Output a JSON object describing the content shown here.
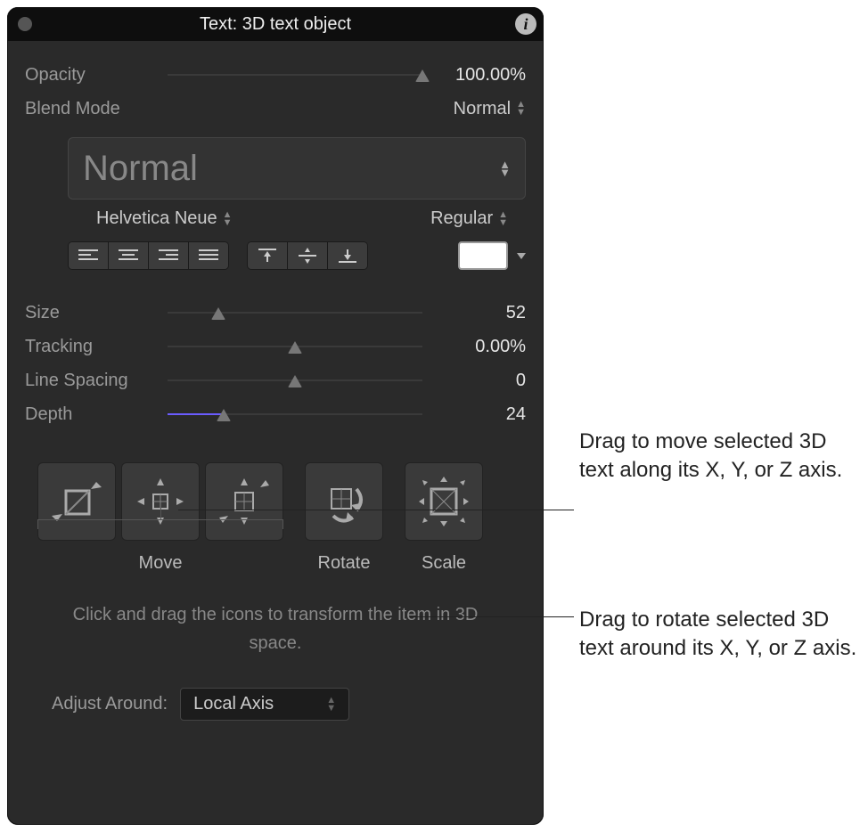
{
  "header": {
    "title": "Text: 3D text  object"
  },
  "opacity": {
    "label": "Opacity",
    "value": "100.00%",
    "pct": 100
  },
  "blend": {
    "label": "Blend Mode",
    "value": "Normal"
  },
  "typeface_dropdown": {
    "label": "Normal"
  },
  "font": {
    "family": "Helvetica Neue",
    "weight": "Regular"
  },
  "size": {
    "label": "Size",
    "value": "52",
    "pct": 20
  },
  "tracking": {
    "label": "Tracking",
    "value": "0.00%",
    "pct": 50
  },
  "linespacing": {
    "label": "Line Spacing",
    "value": "0",
    "pct": 50
  },
  "depth": {
    "label": "Depth",
    "value": "24",
    "pct": 22,
    "show_fill": true
  },
  "tools": {
    "move": "Move",
    "rotate": "Rotate",
    "scale": "Scale"
  },
  "hint": "Click and drag the icons to transform the item in 3D space.",
  "adjust": {
    "label": "Adjust Around:",
    "value": "Local Axis"
  },
  "annotations": {
    "move": "Drag to move selected 3D text along its X, Y, or Z axis.",
    "rotate": "Drag to rotate selected 3D text around its X, Y, or Z axis."
  }
}
